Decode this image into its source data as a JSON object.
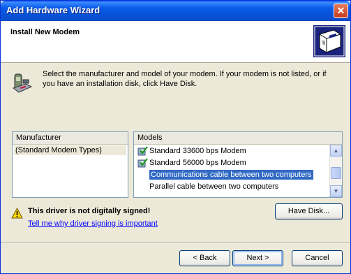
{
  "window": {
    "title": "Add Hardware Wizard",
    "close_label": "✕"
  },
  "header": {
    "title": "Install New Modem"
  },
  "description": "Select the manufacturer and model of your modem. If your modem is not listed, or if you have an installation disk, click Have Disk.",
  "manufacturer": {
    "header": "Manufacturer",
    "items": [
      "(Standard Modem Types)"
    ],
    "selected": "(Standard Modem Types)"
  },
  "models": {
    "header": "Models",
    "items": [
      {
        "label": "Standard 33600 bps Modem",
        "signed": true
      },
      {
        "label": "Standard 56000 bps Modem",
        "signed": true
      },
      {
        "label": "Communications cable between two computers",
        "signed": false,
        "selected": true
      },
      {
        "label": "Parallel cable between two computers",
        "signed": false
      }
    ]
  },
  "warning": {
    "text": "This driver is not digitally signed!",
    "link": "Tell me why driver signing is important"
  },
  "buttons": {
    "have_disk": "Have Disk...",
    "back": "< Back",
    "next": "Next >",
    "cancel": "Cancel"
  },
  "colors": {
    "title_bar": "#0A5CE8",
    "selection": "#316AC5",
    "dialog_bg": "#ECE9D8"
  }
}
